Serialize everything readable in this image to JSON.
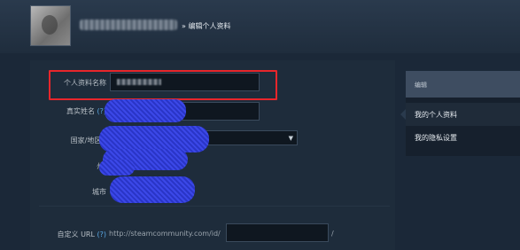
{
  "header": {
    "breadcrumb_separator": "»",
    "page_title": "编辑个人资料"
  },
  "form": {
    "profile_name": {
      "label": "个人资料名称",
      "value": ""
    },
    "real_name": {
      "label": "真实姓名",
      "help": "(?)",
      "value": ""
    },
    "country": {
      "label": "国家/地区",
      "help": "(",
      "value": ""
    },
    "state": {
      "label": "州/",
      "value": ""
    },
    "city": {
      "label": "城市",
      "value": ""
    },
    "custom_url": {
      "label": "自定义 URL",
      "help": "(?)",
      "prefix": "http://steamcommunity.com/id/",
      "suffix": "/",
      "value": ""
    }
  },
  "sidebar": {
    "header": "编辑",
    "items": [
      {
        "label": "我的个人资料",
        "active": true
      },
      {
        "label": "我的隐私设置",
        "active": false
      }
    ]
  },
  "colors": {
    "background": "#1b2838",
    "highlight_box": "#e8262b",
    "redaction_scribble": "#3b48e8",
    "help_link": "#5aa9e6"
  }
}
